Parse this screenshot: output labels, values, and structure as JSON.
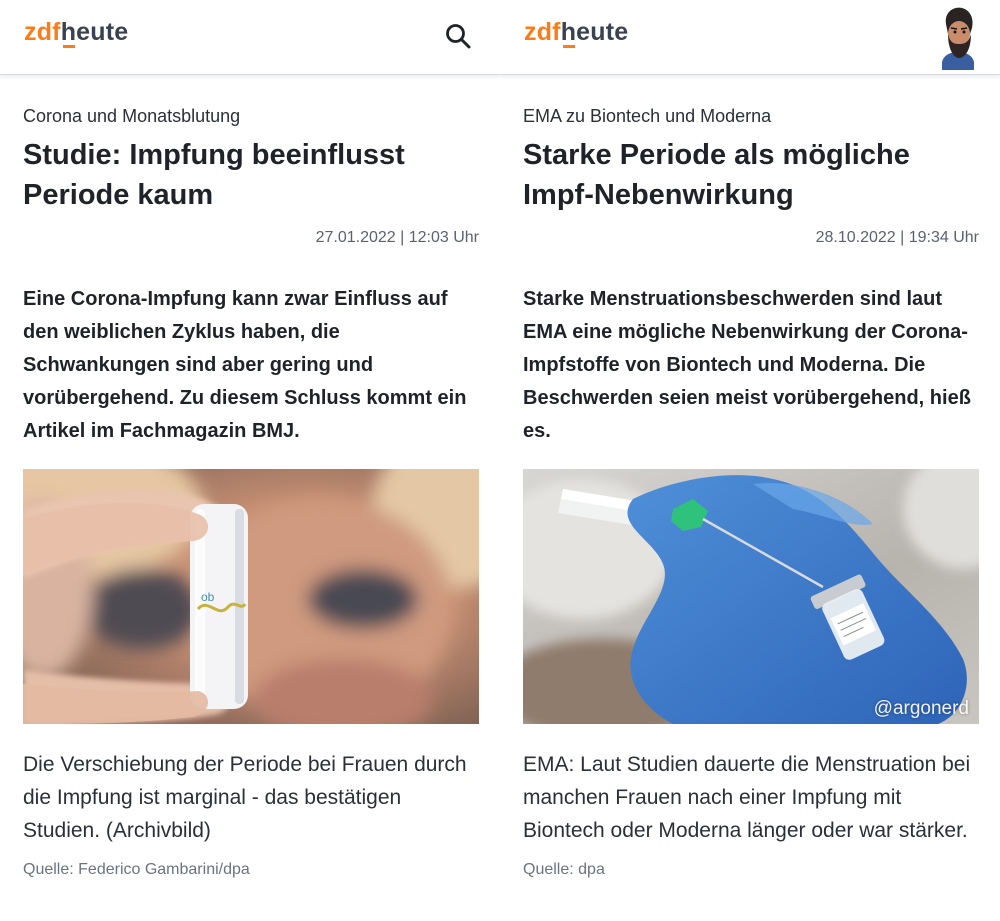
{
  "articles": [
    {
      "logo": {
        "zdf": "zdf",
        "heute": "heute"
      },
      "header_icon": "search-icon",
      "kicker": "Corona und Monatsblutung",
      "title": "Studie: Impfung beeinflusst Periode kaum",
      "datetime": "27.01.2022 | 12:03 Uhr",
      "lead": "Eine Corona-Impfung kann zwar Einfluss auf den weiblichen Zyklus haben, die Schwankungen sind aber gering und vorübergehend. Zu diesem Schluss kommt ein Artikel im Fachmagazin BMJ.",
      "caption": "Die Verschiebung der Periode bei Frauen durch die Impfung ist marginal - das bestätigen Studien. (Archivbild)",
      "source": "Quelle: Federico Gambarini/dpa"
    },
    {
      "logo": {
        "zdf": "zdf",
        "heute": "heute"
      },
      "header_icon": "avatar-icon",
      "kicker": "EMA zu Biontech und Moderna",
      "title": "Starke Periode als mögliche Impf-Nebenwirkung",
      "datetime": "28.10.2022 | 19:34 Uhr",
      "lead": "Starke Menstruationsbeschwerden sind laut EMA eine mögliche Nebenwirkung der Corona-Impfstoffe von Biontech und Moderna. Die Beschwerden seien meist vorübergehend, hieß es.",
      "caption": "EMA: Laut Studien dauerte die Menstruation bei manchen Frauen nach einer Impfung mit Biontech oder Moderna länger oder war stärker.",
      "source": "Quelle: dpa",
      "watermark": "@argonerd"
    }
  ],
  "colors": {
    "brand_orange": "#fa7d19",
    "brand_dark": "#39424e"
  }
}
